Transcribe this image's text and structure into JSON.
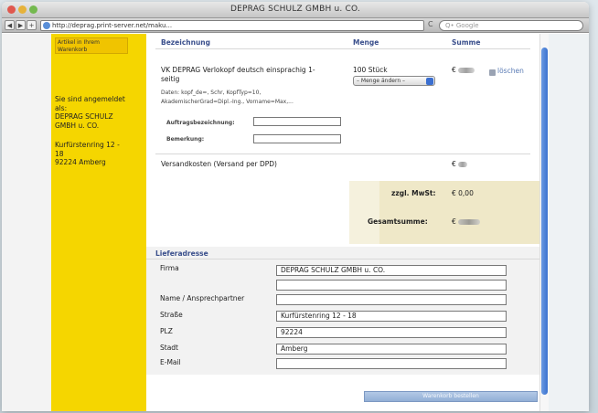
{
  "window": {
    "title": "DEPRAG SCHULZ GMBH u. CO."
  },
  "toolbar": {
    "url": "http://deprag.print-server.net/maku...",
    "reload_icon": "C",
    "search_placeholder": "Q• Google"
  },
  "sidebar": {
    "cart_link": "Artikel in Ihrem Warenkorb",
    "login_line1": "Sie sind angemeldet",
    "login_line2": "als:",
    "login_line3": "DEPRAG SCHULZ",
    "login_line4": "GMBH u. CO.",
    "addr_line1": "Kurfürstenring 12 -",
    "addr_line2": "18",
    "addr_line3": "92224 Amberg"
  },
  "cart": {
    "headers": {
      "name": "Bezeichnung",
      "qty": "Menge",
      "sum": "Summe"
    },
    "item": {
      "title_line1": "VK DEPRAG Verlokopf deutsch einsprachig 1-",
      "title_line2": "seitig",
      "qty": "100 Stück",
      "qty_select": "– Menge ändern –",
      "price": "€",
      "delete_label": "löschen",
      "data_line1": "Daten: kopf_de=, Schr, KopfTyp=10,",
      "data_line2": "AkademischerGrad=Dipl.-Ing., Vorname=Max,..."
    },
    "order_label": "Auftragsbezeichnung:",
    "note_label": "Bemerkung:",
    "shipping_label": "Versandkosten (Versand per DPD)",
    "shipping_price": "€",
    "vat_label": "zzgl. MwSt:",
    "vat_value": "€ 0,00",
    "total_label": "Gesamtsumme:",
    "total_value": "€"
  },
  "address": {
    "heading": "Lieferadresse",
    "firma_label": "Firma",
    "firma_value": "DEPRAG SCHULZ GMBH u. CO.",
    "contact_label": "Name / Ansprechpartner",
    "street_label": "Straße",
    "street_value": "Kurfürstenring 12 - 18",
    "zip_label": "PLZ",
    "zip_value": "92224",
    "city_label": "Stadt",
    "city_value": "Amberg",
    "email_label": "E-Mail"
  },
  "actions": {
    "submit": "Warenkorb bestellen"
  }
}
